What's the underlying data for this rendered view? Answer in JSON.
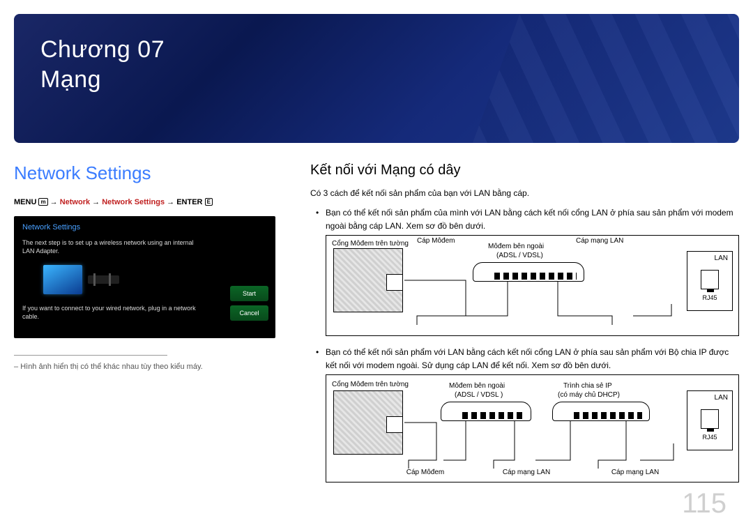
{
  "chapter": {
    "label": "Chương 07",
    "title": "Mạng"
  },
  "left": {
    "heading": "Network Settings",
    "breadcrumb": {
      "menu": "MENU",
      "menu_icon": "m",
      "arrow": "→",
      "network": "Network",
      "settings": "Network Settings",
      "enter": "ENTER",
      "enter_icon": "E"
    },
    "mock": {
      "title": "Network Settings",
      "text1": "The next step is to set up a wireless network using an internal LAN Adapter.",
      "text2": "If you want to connect to your wired network, plug in a network cable.",
      "btn1": "Start",
      "btn2": "Cancel"
    },
    "footnote": "Hình ảnh hiển thị có thể khác nhau tùy theo kiểu máy."
  },
  "right": {
    "heading": "Kết nối với Mạng có dây",
    "intro": "Có 3 cách để kết nối sản phẩm của bạn với LAN bằng cáp.",
    "bullets": [
      "Bạn có thể kết nối sản phẩm của mình với LAN bằng cách kết nối cổng LAN ở phía sau sản phẩm với modem ngoài bằng cáp LAN. Xem sơ đồ bên dưới.",
      "Bạn có thể kết nối sản phẩm với LAN bằng cách kết nối cổng LAN ở phía sau sản phẩm với Bộ chia IP được kết nối với modem ngoài. Sử dụng cáp LAN để kết nối. Xem sơ đồ bên dưới."
    ],
    "diagram1": {
      "wall": "Cổng Môđem trên tường",
      "modem": "Môđem bên ngoài",
      "modem_sub": "(ADSL / VDSL)",
      "cable_modem": "Cáp Môđem",
      "cable_lan": "Cáp mạng LAN",
      "lan": "LAN",
      "rj45": "RJ45"
    },
    "diagram2": {
      "wall": "Cổng Môđem trên tường",
      "modem": "Môđem bên ngoài",
      "modem_sub": "(ADSL / VDSL )",
      "router": "Trình chia sẻ IP",
      "router_sub": "(có máy chủ DHCP)",
      "cable_modem": "Cáp Môđem",
      "cable_lan": "Cáp mạng LAN",
      "lan": "LAN",
      "rj45": "RJ45"
    }
  },
  "page_number": "115"
}
